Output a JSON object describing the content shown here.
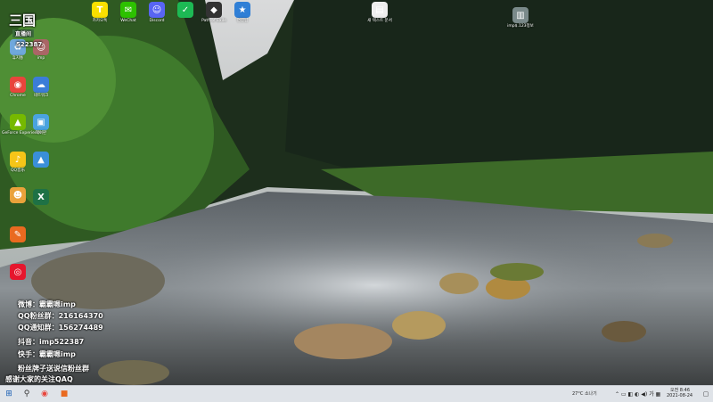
{
  "desktop_icons": [
    {
      "id": "recycle",
      "label": "휴지통",
      "color": "#6fa8dc",
      "glyph": "♻"
    },
    {
      "id": "chrome",
      "label": "Chrome",
      "color": "#e8453c",
      "glyph": "◉"
    },
    {
      "id": "geforce",
      "label": "GeForce Experience",
      "color": "#76b900",
      "glyph": "▲"
    },
    {
      "id": "qq",
      "label": "QQ音乐",
      "color": "#f5c518",
      "glyph": "♪"
    },
    {
      "id": "kakao",
      "label": "카카오톡",
      "color": "#f9e000",
      "glyph": "T"
    },
    {
      "id": "wechat",
      "label": "WeChat",
      "color": "#2dc100",
      "glyph": "✉"
    },
    {
      "id": "discord",
      "label": "Discord",
      "color": "#5865f2",
      "glyph": "☺"
    },
    {
      "id": "green",
      "label": "",
      "color": "#1db954",
      "glyph": "✓"
    },
    {
      "id": "poe",
      "label": "Path of Exile",
      "color": "#333",
      "glyph": "◆"
    },
    {
      "id": "blue",
      "label": "연결됨",
      "color": "#2f7fd6",
      "glyph": "★"
    },
    {
      "id": "folder1",
      "label": "새 텍스트 문서",
      "color": "#eeeeee",
      "glyph": "▤"
    },
    {
      "id": "folder2",
      "label": "imp$.123정보",
      "color": "#7a8a8a",
      "glyph": "▥"
    },
    {
      "id": "mascot",
      "label": "",
      "color": "#e9a23b",
      "glyph": "☻"
    },
    {
      "id": "excel",
      "label": "",
      "color": "#1e7145",
      "glyph": "X"
    },
    {
      "id": "orange",
      "label": "",
      "color": "#e96a20",
      "glyph": "✎"
    },
    {
      "id": "weibo",
      "label": "",
      "color": "#e6162d",
      "glyph": "◎"
    },
    {
      "id": "net",
      "label": "네트워크",
      "color": "#3b7dd8",
      "glyph": "☁"
    },
    {
      "id": "ctrl",
      "label": "제어판",
      "color": "#4aa3df",
      "glyph": "▣"
    },
    {
      "id": "img",
      "label": "",
      "color": "#3a8fd9",
      "glyph": "▲"
    },
    {
      "id": "user",
      "label": "imp",
      "color": "#a66",
      "glyph": "☺"
    }
  ],
  "overlay": {
    "logo": "三国",
    "logo_sub": "直播间",
    "room_id": "522387",
    "lines": [
      "微博：霸霸嗯imp",
      "QQ粉丝群：216164370",
      "QQ通知群：156274489",
      "抖音：imp522387",
      "快手：霸霸嗯imp",
      "粉丝牌子送说信粉丝群",
      "感谢大家的关注QAQ"
    ]
  },
  "taskbar": {
    "start_icon": "windows-icon",
    "weather": "27°C 소나기",
    "time": "오전 8:46",
    "date": "2021-08-24"
  }
}
